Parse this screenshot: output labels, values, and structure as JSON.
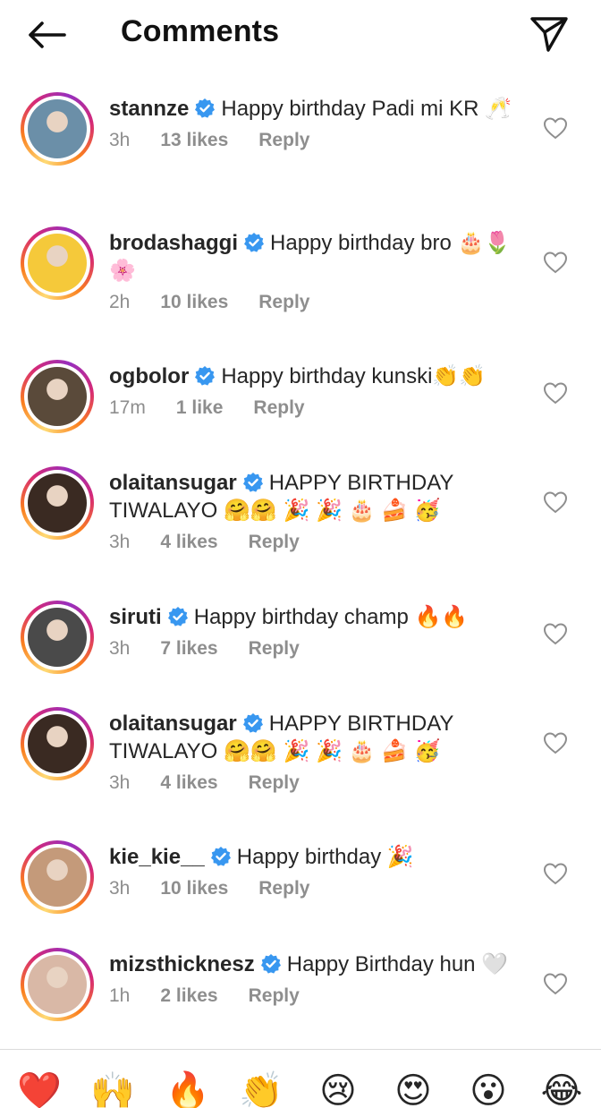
{
  "header": {
    "title": "Comments"
  },
  "comments": [
    {
      "username": "stannze",
      "text": "Happy birthday Padi mi KR 🥂",
      "time": "3h",
      "likes": "13 likes",
      "reply": "Reply",
      "avatar_color": "#6b8fa8"
    },
    {
      "username": "brodashaggi",
      "text": "Happy birthday bro 🎂🌷🌸",
      "time": "2h",
      "likes": "10 likes",
      "reply": "Reply",
      "avatar_color": "#f5c93a"
    },
    {
      "username": "ogbolor",
      "text": "Happy birthday kunski👏👏",
      "time": "17m",
      "likes": "1 like",
      "reply": "Reply",
      "avatar_color": "#5a4a3a"
    },
    {
      "username": "olaitansugar",
      "text": "HAPPY BIRTHDAY TIWALAYO 🤗🤗 🎉 🎉 🎂 🍰 🥳",
      "time": "3h",
      "likes": "4 likes",
      "reply": "Reply",
      "avatar_color": "#3a2a22"
    },
    {
      "username": "siruti",
      "text": "Happy birthday champ 🔥🔥",
      "time": "3h",
      "likes": "7 likes",
      "reply": "Reply",
      "avatar_color": "#4a4a4a"
    },
    {
      "username": "olaitansugar",
      "text": "HAPPY BIRTHDAY TIWALAYO 🤗🤗 🎉 🎉 🎂 🍰 🥳",
      "time": "3h",
      "likes": "4 likes",
      "reply": "Reply",
      "avatar_color": "#3a2a22"
    },
    {
      "username": "kie_kie__",
      "text": "Happy birthday 🎉",
      "time": "3h",
      "likes": "10 likes",
      "reply": "Reply",
      "avatar_color": "#c49a7a"
    },
    {
      "username": "mizsthicknesz",
      "text": "Happy Birthday hun 🤍",
      "time": "1h",
      "likes": "2 likes",
      "reply": "Reply",
      "avatar_color": "#d9b8a6"
    }
  ],
  "emoji_bar": [
    "❤️",
    "🙌",
    "🔥",
    "👏",
    "😢",
    "😍",
    "😮",
    "😂"
  ],
  "colors": {
    "verified": "#3897f0",
    "meta": "#8e8e8e",
    "text": "#262626"
  }
}
